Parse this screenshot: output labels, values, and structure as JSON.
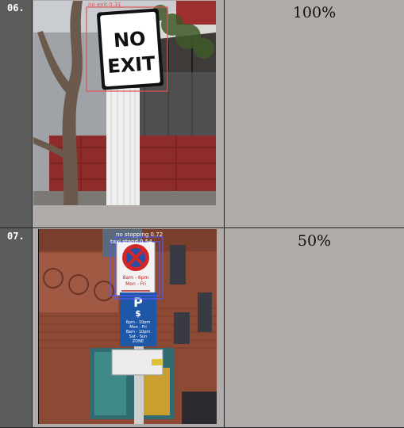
{
  "rows": [
    {
      "index": "06.",
      "score": "100%",
      "photo": {
        "sign_line1": "NO",
        "sign_line2": "EXIT",
        "detections": [
          {
            "label": "no exit 0.31",
            "color": "#e05555"
          }
        ]
      }
    },
    {
      "index": "07.",
      "score": "50%",
      "photo": {
        "sign_top_line1": "8am - 6pm",
        "sign_top_line2": "Mon - Fri",
        "sign_p": "P",
        "sign_dollar": "$",
        "sign_p_lines": [
          "6pm - 10pm",
          "Mon - Fri",
          "8am - 10pm",
          "Sat - Sun",
          "ZONE"
        ],
        "detections": [
          {
            "label": "no stopping 0.72",
            "color": "#5b5bf0"
          },
          {
            "label": "taxi stand 0.54",
            "color": "#5b5bf0"
          }
        ]
      }
    }
  ]
}
